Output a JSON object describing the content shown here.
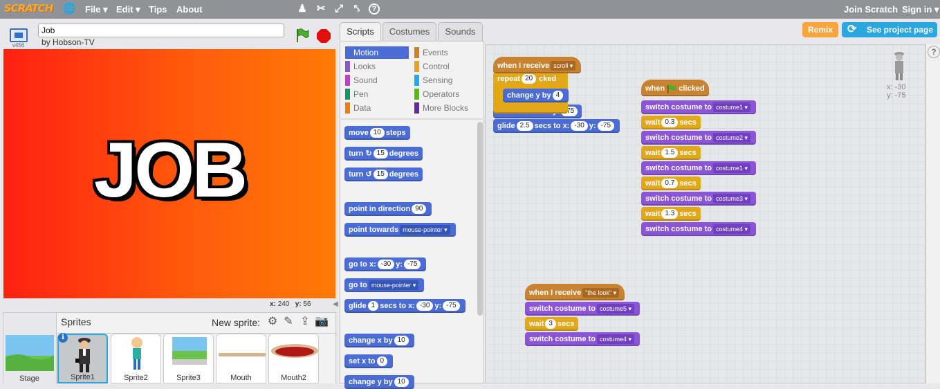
{
  "topbar": {
    "logo": "SCRATCH",
    "menu": [
      "File",
      "Edit",
      "Tips",
      "About"
    ],
    "join": "Join Scratch",
    "signin": "Sign in"
  },
  "project": {
    "title": "Job",
    "author": "by Hobson-TV",
    "version": "v456",
    "stage_text": "JOB",
    "x_label": "x:",
    "x": "240",
    "y_label": "y:",
    "y": "56"
  },
  "sprites": {
    "header": "Sprites",
    "new_sprite": "New sprite:",
    "items": [
      "Stage",
      "Sprite1",
      "Sprite2",
      "Sprite3",
      "Mouth",
      "Mouth2"
    ]
  },
  "tabs": [
    "Scripts",
    "Costumes",
    "Sounds"
  ],
  "buttons": {
    "remix": "Remix",
    "see_page": "See project page"
  },
  "categories": [
    {
      "label": "Motion",
      "color": "#4a6cd4"
    },
    {
      "label": "Events",
      "color": "#c88330"
    },
    {
      "label": "Looks",
      "color": "#8a55d7"
    },
    {
      "label": "Control",
      "color": "#e1a91a"
    },
    {
      "label": "Sound",
      "color": "#bb42c3"
    },
    {
      "label": "Sensing",
      "color": "#2ca5e2"
    },
    {
      "label": "Pen",
      "color": "#0e9a6c"
    },
    {
      "label": "Operators",
      "color": "#5cb712"
    },
    {
      "label": "Data",
      "color": "#ee7d16"
    },
    {
      "label": "More Blocks",
      "color": "#632d99"
    }
  ],
  "palette": {
    "move": "move",
    "move_n": "10",
    "steps": "steps",
    "turn": "turn",
    "turn_n": "15",
    "degrees": "degrees",
    "point_dir": "point in direction",
    "point_dir_n": "90",
    "point_towards": "point towards",
    "mouse_pointer": "mouse-pointer",
    "goto": "go to",
    "x_label": "x:",
    "goto_x": "-30",
    "y_label": "y:",
    "goto_y": "-75",
    "glide": "glide",
    "glide_n": "1",
    "secs_to": "secs to",
    "change_x": "change x by",
    "change_x_n": "10",
    "set_x": "set x to",
    "set_x_n": "0",
    "change_y": "change y by",
    "change_y_n": "10"
  },
  "scripts": {
    "s1_hat": "when I receive",
    "s1_msg": "scroll",
    "repeat": "repeat",
    "repeat_n": "20",
    "hidden_tail": "cked",
    "change_y": "change y by",
    "change_y_n": "4",
    "y_label": "y:",
    "y_val": "-75",
    "glide": "glide",
    "glide_n": "2.5",
    "secs_to": "secs to",
    "x_label": "x:",
    "glide_x": "-30",
    "glide_y": "-75",
    "s2_when": "when",
    "s2_clicked": "clicked",
    "switch": "switch costume to",
    "wait": "wait",
    "secs": "secs",
    "c1": "costume1",
    "w1": "0.3",
    "c2": "costume2",
    "w2": "1.5",
    "c3": "costume1",
    "w3": "0.7",
    "c4": "costume3",
    "w4": "1.3",
    "c5": "costume4",
    "s3_hat": "when I receive",
    "s3_msg": "\"the look\"",
    "c6": "costume5",
    "w6": "3",
    "c7": "costume4"
  },
  "sprite_info": {
    "x": "x: -30",
    "y": "y: -75"
  }
}
